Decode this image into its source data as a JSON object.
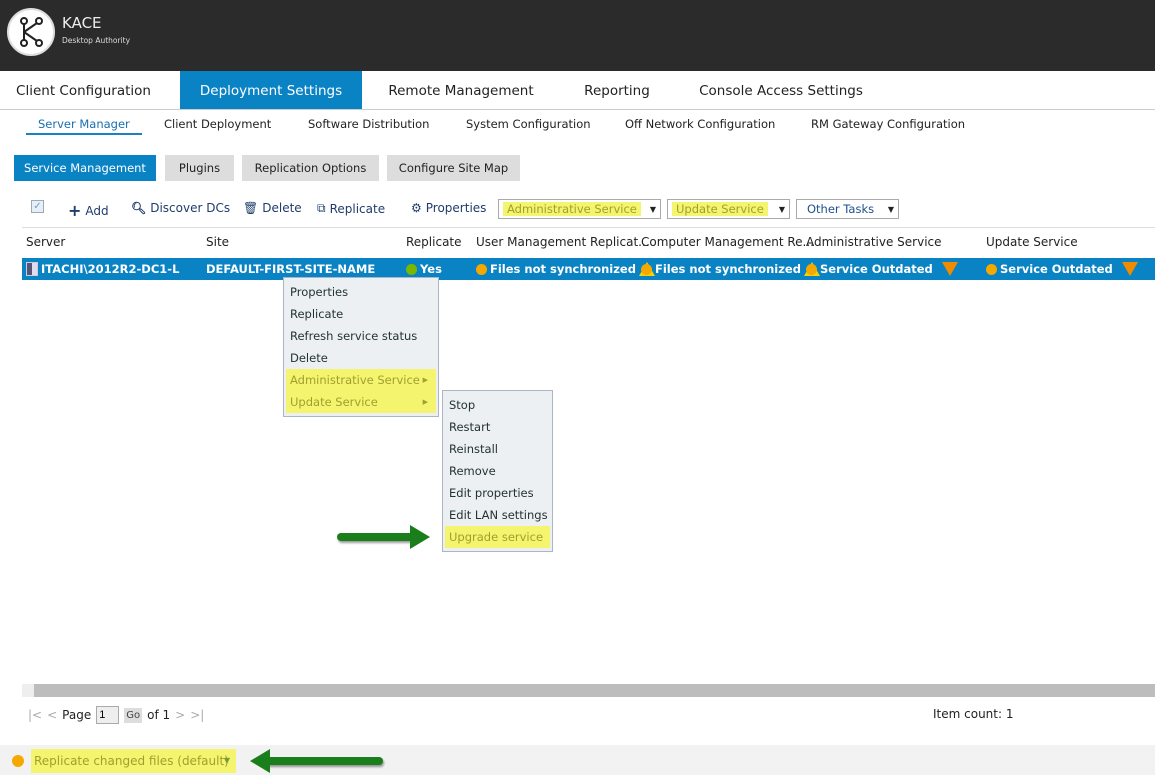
{
  "app": {
    "brand": "KACE",
    "brand_sub": "Desktop Authority"
  },
  "top_nav": [
    "Client Configuration",
    "Deployment Settings",
    "Remote Management",
    "Reporting",
    "Console Access Settings"
  ],
  "sub_nav": [
    "Server Manager",
    "Client Deployment",
    "Software Distribution",
    "System Configuration",
    "Off Network Configuration",
    "RM Gateway Configuration"
  ],
  "tabs": [
    "Service Management",
    "Plugins",
    "Replication Options",
    "Configure Site Map"
  ],
  "toolbar": {
    "add": "Add",
    "discover": "Discover DCs",
    "delete": "Delete",
    "replicate": "Replicate",
    "properties": "Properties",
    "admin_service": "Administrative Service",
    "update_service": "Update Service",
    "other_tasks": "Other Tasks"
  },
  "columns": [
    "Server",
    "Site",
    "Replicate",
    "User Management Replicat...",
    "Computer Management Re...",
    "Administrative Service",
    "Update Service"
  ],
  "row": {
    "server": "ITACHI\\2012R2-DC1-L",
    "site": "DEFAULT-FIRST-SITE-NAME",
    "replicate": "Yes",
    "user_mgmt": "Files not synchronized",
    "computer_mgmt": "Files not synchronized",
    "admin_service": "Service Outdated",
    "update_service": "Service Outdated"
  },
  "context_menu": [
    "Properties",
    "Replicate",
    "Refresh service status",
    "Delete",
    "Administrative Service",
    "Update Service"
  ],
  "submenu": [
    "Stop",
    "Restart",
    "Reinstall",
    "Remove",
    "Edit properties",
    "Edit LAN settings",
    "Upgrade service"
  ],
  "pager": {
    "page_label": "Page",
    "page": "1",
    "go": "Go",
    "of": "of 1",
    "item_count": "Item count: 1"
  },
  "status": {
    "replication_mode": "Replicate changed files (default)"
  },
  "colors": {
    "accent": "#0a83c4",
    "highlight": "#f4f46e",
    "ok": "#7ab800",
    "warn": "#f5a800"
  }
}
